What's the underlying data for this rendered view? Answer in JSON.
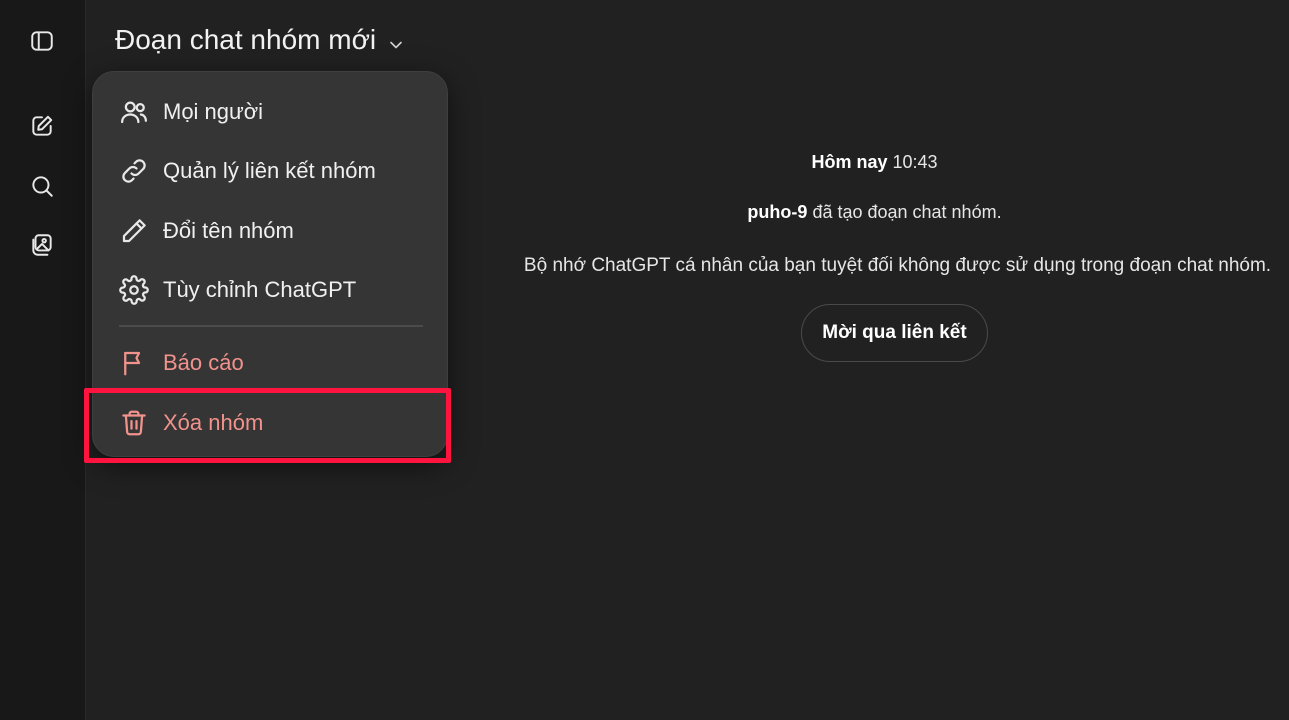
{
  "rail": {
    "icons": [
      "sidebar-toggle-icon",
      "new-chat-icon",
      "search-icon",
      "images-icon"
    ]
  },
  "header": {
    "title": "Đoạn chat nhóm mới"
  },
  "menu": {
    "items": [
      {
        "label": "Mọi người",
        "icon": "people-icon"
      },
      {
        "label": "Quản lý liên kết nhóm",
        "icon": "link-icon"
      },
      {
        "label": "Đổi tên nhóm",
        "icon": "pencil-icon"
      },
      {
        "label": "Tùy chỉnh ChatGPT",
        "icon": "gear-icon"
      },
      {
        "label": "Báo cáo",
        "icon": "flag-icon"
      },
      {
        "label": "Xóa nhóm",
        "icon": "trash-icon"
      }
    ],
    "danger_color": "#f1928c",
    "highlight_color": "#ff1440"
  },
  "chat": {
    "day_label": "Hôm nay",
    "time": "10:43",
    "creator": "puho-9",
    "created_text": "đã tạo đoạn chat nhóm.",
    "memory_note": "Bộ nhớ ChatGPT cá nhân của bạn tuyệt đối không được sử dụng trong đoạn chat nhóm.",
    "invite_label": "Mời qua liên kết"
  }
}
